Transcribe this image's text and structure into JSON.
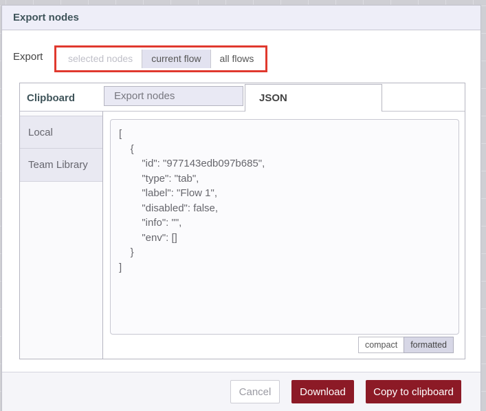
{
  "dialog": {
    "title": "Export nodes",
    "export_label": "Export",
    "scope_buttons": {
      "selected_nodes": "selected nodes",
      "current_flow": "current flow",
      "all_flows": "all flows",
      "selected_value": "current flow"
    },
    "library": {
      "clipboard_label": "Clipboard",
      "tabs": {
        "export_nodes": "Export nodes",
        "json": "JSON",
        "active": "JSON"
      },
      "sidebar": {
        "local": "Local",
        "team_library": "Team Library"
      },
      "code": "[\n    {\n        \"id\": \"977143edb097b685\",\n        \"type\": \"tab\",\n        \"label\": \"Flow 1\",\n        \"disabled\": false,\n        \"info\": \"\",\n        \"env\": []\n    }\n]",
      "format_buttons": {
        "compact": "compact",
        "formatted": "formatted",
        "selected_value": "formatted"
      }
    },
    "footer": {
      "cancel": "Cancel",
      "download": "Download",
      "copy": "Copy to clipboard"
    }
  },
  "colors": {
    "annotation_red": "#e0392e",
    "primary_button": "#8c1a26",
    "header_bg": "#eeeef8",
    "selected_lavender": "#e2e2f0",
    "title_text": "#3f545a"
  }
}
